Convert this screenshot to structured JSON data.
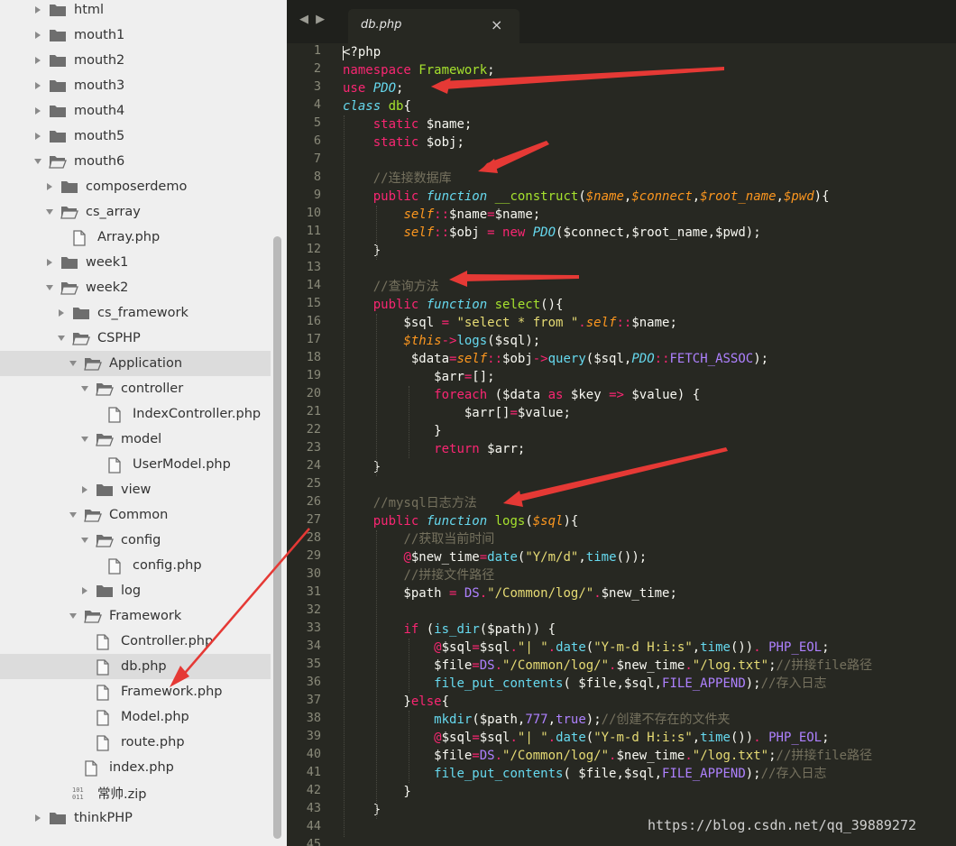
{
  "sidebar": {
    "items": [
      {
        "label": "html",
        "type": "folder",
        "state": "closed",
        "depth": 0
      },
      {
        "label": "mouth1",
        "type": "folder",
        "state": "closed",
        "depth": 0
      },
      {
        "label": "mouth2",
        "type": "folder",
        "state": "closed",
        "depth": 0
      },
      {
        "label": "mouth3",
        "type": "folder",
        "state": "closed",
        "depth": 0
      },
      {
        "label": "mouth4",
        "type": "folder",
        "state": "closed",
        "depth": 0
      },
      {
        "label": "mouth5",
        "type": "folder",
        "state": "closed",
        "depth": 0
      },
      {
        "label": "mouth6",
        "type": "folder",
        "state": "open",
        "depth": 0
      },
      {
        "label": "composerdemo",
        "type": "folder",
        "state": "closed",
        "depth": 1
      },
      {
        "label": "cs_array",
        "type": "folder",
        "state": "open",
        "depth": 1
      },
      {
        "label": "Array.php",
        "type": "file",
        "depth": 2
      },
      {
        "label": "week1",
        "type": "folder",
        "state": "closed",
        "depth": 1
      },
      {
        "label": "week2",
        "type": "folder",
        "state": "open",
        "depth": 1
      },
      {
        "label": "cs_framework",
        "type": "folder",
        "state": "closed",
        "depth": 2
      },
      {
        "label": "CSPHP",
        "type": "folder",
        "state": "open",
        "depth": 2
      },
      {
        "label": "Application",
        "type": "folder",
        "state": "open",
        "depth": 3,
        "selected": true
      },
      {
        "label": "controller",
        "type": "folder",
        "state": "open",
        "depth": 4
      },
      {
        "label": "IndexController.php",
        "type": "file",
        "depth": 5
      },
      {
        "label": "model",
        "type": "folder",
        "state": "open",
        "depth": 4
      },
      {
        "label": "UserModel.php",
        "type": "file",
        "depth": 5
      },
      {
        "label": "view",
        "type": "folder",
        "state": "closed",
        "depth": 4
      },
      {
        "label": "Common",
        "type": "folder",
        "state": "open",
        "depth": 3
      },
      {
        "label": "config",
        "type": "folder",
        "state": "open",
        "depth": 4
      },
      {
        "label": "config.php",
        "type": "file",
        "depth": 5
      },
      {
        "label": "log",
        "type": "folder",
        "state": "closed",
        "depth": 4
      },
      {
        "label": "Framework",
        "type": "folder",
        "state": "open",
        "depth": 3
      },
      {
        "label": "Controller.php",
        "type": "file",
        "depth": 4
      },
      {
        "label": "db.php",
        "type": "file",
        "depth": 4,
        "selected": true
      },
      {
        "label": "Framework.php",
        "type": "file",
        "depth": 4
      },
      {
        "label": "Model.php",
        "type": "file",
        "depth": 4
      },
      {
        "label": "route.php",
        "type": "file",
        "depth": 4
      },
      {
        "label": "index.php",
        "type": "file",
        "depth": 3
      },
      {
        "label": "常帅.zip",
        "type": "zip",
        "depth": 2
      },
      {
        "label": "thinkPHP",
        "type": "folder",
        "state": "closed",
        "depth": 0
      }
    ]
  },
  "editor": {
    "tab_nav": "◀ ▶",
    "tab_title": "db.php",
    "tab_close": "×",
    "line_numbers": [
      "1",
      "2",
      "3",
      "4",
      "5",
      "6",
      "7",
      "8",
      "9",
      "10",
      "11",
      "12",
      "13",
      "14",
      "15",
      "16",
      "17",
      "18",
      "19",
      "20",
      "21",
      "22",
      "23",
      "24",
      "25",
      "26",
      "27",
      "28",
      "29",
      "30",
      "31",
      "32",
      "33",
      "34",
      "35",
      "36",
      "37",
      "38",
      "39",
      "40",
      "41",
      "42",
      "43",
      "44",
      "45"
    ],
    "lines": [
      [
        [
          "w",
          "<?php"
        ]
      ],
      [
        [
          "k",
          "namespace "
        ],
        [
          "n",
          "Framework"
        ],
        [
          "w",
          ";"
        ]
      ],
      [
        [
          "k",
          "use "
        ],
        [
          "s",
          "PDO"
        ],
        [
          "w",
          ";"
        ]
      ],
      [
        [
          "s",
          "class "
        ],
        [
          "n",
          "db"
        ],
        [
          "w",
          "{"
        ]
      ],
      [
        [
          "w",
          "    "
        ],
        [
          "k",
          "static "
        ],
        [
          "w",
          "$name;"
        ]
      ],
      [
        [
          "w",
          "    "
        ],
        [
          "k",
          "static "
        ],
        [
          "w",
          "$obj;"
        ]
      ],
      [
        [
          "w",
          ""
        ]
      ],
      [
        [
          "w",
          "    "
        ],
        [
          "c",
          "//连接数据库"
        ]
      ],
      [
        [
          "w",
          "    "
        ],
        [
          "k",
          "public "
        ],
        [
          "s",
          "function "
        ],
        [
          "n",
          "__construct"
        ],
        [
          "w",
          "("
        ],
        [
          "p",
          "$name"
        ],
        [
          "w",
          ","
        ],
        [
          "p",
          "$connect"
        ],
        [
          "w",
          ","
        ],
        [
          "p",
          "$root_name"
        ],
        [
          "w",
          ","
        ],
        [
          "p",
          "$pwd"
        ],
        [
          "w",
          "){"
        ]
      ],
      [
        [
          "w",
          "        "
        ],
        [
          "p",
          "self"
        ],
        [
          "k",
          "::"
        ],
        [
          "w",
          "$name"
        ],
        [
          "k",
          "="
        ],
        [
          "w",
          "$name;"
        ]
      ],
      [
        [
          "w",
          "        "
        ],
        [
          "p",
          "self"
        ],
        [
          "k",
          "::"
        ],
        [
          "w",
          "$obj "
        ],
        [
          "k",
          "= new "
        ],
        [
          "s",
          "PDO"
        ],
        [
          "w",
          "($connect,$root_name,$pwd);"
        ]
      ],
      [
        [
          "w",
          "    }"
        ]
      ],
      [
        [
          "w",
          ""
        ]
      ],
      [
        [
          "w",
          "    "
        ],
        [
          "c",
          "//查询方法"
        ]
      ],
      [
        [
          "w",
          "    "
        ],
        [
          "k",
          "public "
        ],
        [
          "s",
          "function "
        ],
        [
          "n",
          "select"
        ],
        [
          "w",
          "(){"
        ]
      ],
      [
        [
          "w",
          "        $sql "
        ],
        [
          "k",
          "= "
        ],
        [
          "str",
          "\"select * from \""
        ],
        [
          "k",
          "."
        ],
        [
          "p",
          "self"
        ],
        [
          "k",
          "::"
        ],
        [
          "w",
          "$name;"
        ]
      ],
      [
        [
          "w",
          "        "
        ],
        [
          "p",
          "$this"
        ],
        [
          "k",
          "->"
        ],
        [
          "fn",
          "logs"
        ],
        [
          "w",
          "($sql);"
        ]
      ],
      [
        [
          "w",
          "         $data"
        ],
        [
          "k",
          "="
        ],
        [
          "p",
          "self"
        ],
        [
          "k",
          "::"
        ],
        [
          "w",
          "$obj"
        ],
        [
          "k",
          "->"
        ],
        [
          "fn",
          "query"
        ],
        [
          "w",
          "($sql,"
        ],
        [
          "s",
          "PDO"
        ],
        [
          "k",
          "::"
        ],
        [
          "cn",
          "FETCH_ASSOC"
        ],
        [
          "w",
          ");"
        ]
      ],
      [
        [
          "w",
          "            $arr"
        ],
        [
          "k",
          "="
        ],
        [
          "w",
          "[];"
        ]
      ],
      [
        [
          "w",
          "            "
        ],
        [
          "k",
          "foreach "
        ],
        [
          "w",
          "($data "
        ],
        [
          "k",
          "as "
        ],
        [
          "w",
          "$key "
        ],
        [
          "k",
          "=> "
        ],
        [
          "w",
          "$value) {"
        ]
      ],
      [
        [
          "w",
          "                $arr[]"
        ],
        [
          "k",
          "="
        ],
        [
          "w",
          "$value;"
        ]
      ],
      [
        [
          "w",
          "            }"
        ]
      ],
      [
        [
          "w",
          "            "
        ],
        [
          "k",
          "return "
        ],
        [
          "w",
          "$arr;"
        ]
      ],
      [
        [
          "w",
          "    }"
        ]
      ],
      [
        [
          "w",
          ""
        ]
      ],
      [
        [
          "w",
          "    "
        ],
        [
          "c",
          "//mysql日志方法"
        ]
      ],
      [
        [
          "w",
          "    "
        ],
        [
          "k",
          "public "
        ],
        [
          "s",
          "function "
        ],
        [
          "n",
          "logs"
        ],
        [
          "w",
          "("
        ],
        [
          "p",
          "$sql"
        ],
        [
          "w",
          "){"
        ]
      ],
      [
        [
          "w",
          "        "
        ],
        [
          "c",
          "//获取当前时间"
        ]
      ],
      [
        [
          "w",
          "        "
        ],
        [
          "k",
          "@"
        ],
        [
          "w",
          "$new_time"
        ],
        [
          "k",
          "="
        ],
        [
          "fn",
          "date"
        ],
        [
          "w",
          "("
        ],
        [
          "str",
          "\"Y/m/d\""
        ],
        [
          "w",
          ","
        ],
        [
          "fn",
          "time"
        ],
        [
          "w",
          "());"
        ]
      ],
      [
        [
          "w",
          "        "
        ],
        [
          "c",
          "//拼接文件路径"
        ]
      ],
      [
        [
          "w",
          "        $path "
        ],
        [
          "k",
          "= "
        ],
        [
          "cn",
          "DS"
        ],
        [
          "k",
          "."
        ],
        [
          "str",
          "\"/Common/log/\""
        ],
        [
          "k",
          "."
        ],
        [
          "w",
          "$new_time;"
        ]
      ],
      [
        [
          "w",
          ""
        ]
      ],
      [
        [
          "w",
          "        "
        ],
        [
          "k",
          "if "
        ],
        [
          "w",
          "("
        ],
        [
          "fn",
          "is_dir"
        ],
        [
          "w",
          "($path)) {"
        ]
      ],
      [
        [
          "w",
          "            "
        ],
        [
          "k",
          "@"
        ],
        [
          "w",
          "$sql"
        ],
        [
          "k",
          "="
        ],
        [
          "w",
          "$sql"
        ],
        [
          "k",
          "."
        ],
        [
          "str",
          "\"| \""
        ],
        [
          "k",
          "."
        ],
        [
          "fn",
          "date"
        ],
        [
          "w",
          "("
        ],
        [
          "str",
          "\"Y-m-d H:i:s\""
        ],
        [
          "w",
          ","
        ],
        [
          "fn",
          "time"
        ],
        [
          "w",
          "())"
        ],
        [
          "k",
          ". "
        ],
        [
          "cn",
          "PHP_EOL"
        ],
        [
          "w",
          ";"
        ]
      ],
      [
        [
          "w",
          "            $file"
        ],
        [
          "k",
          "="
        ],
        [
          "cn",
          "DS"
        ],
        [
          "k",
          "."
        ],
        [
          "str",
          "\"/Common/log/\""
        ],
        [
          "k",
          "."
        ],
        [
          "w",
          "$new_time"
        ],
        [
          "k",
          "."
        ],
        [
          "str",
          "\"/log.txt\""
        ],
        [
          "w",
          ";"
        ],
        [
          "c",
          "//拼接file路径"
        ]
      ],
      [
        [
          "w",
          "            "
        ],
        [
          "fn",
          "file_put_contents"
        ],
        [
          "w",
          "( $file,$sql,"
        ],
        [
          "cn",
          "FILE_APPEND"
        ],
        [
          "w",
          ");"
        ],
        [
          "c",
          "//存入日志"
        ]
      ],
      [
        [
          "w",
          "        }"
        ],
        [
          "k",
          "else"
        ],
        [
          "w",
          "{"
        ]
      ],
      [
        [
          "w",
          "            "
        ],
        [
          "fn",
          "mkdir"
        ],
        [
          "w",
          "($path,"
        ],
        [
          "num",
          "777"
        ],
        [
          "w",
          ","
        ],
        [
          "num",
          "true"
        ],
        [
          "w",
          ");"
        ],
        [
          "c",
          "//创建不存在的文件夹"
        ]
      ],
      [
        [
          "w",
          "            "
        ],
        [
          "k",
          "@"
        ],
        [
          "w",
          "$sql"
        ],
        [
          "k",
          "="
        ],
        [
          "w",
          "$sql"
        ],
        [
          "k",
          "."
        ],
        [
          "str",
          "\"| \""
        ],
        [
          "k",
          "."
        ],
        [
          "fn",
          "date"
        ],
        [
          "w",
          "("
        ],
        [
          "str",
          "\"Y-m-d H:i:s\""
        ],
        [
          "w",
          ","
        ],
        [
          "fn",
          "time"
        ],
        [
          "w",
          "())"
        ],
        [
          "k",
          ". "
        ],
        [
          "cn",
          "PHP_EOL"
        ],
        [
          "w",
          ";"
        ]
      ],
      [
        [
          "w",
          "            $file"
        ],
        [
          "k",
          "="
        ],
        [
          "cn",
          "DS"
        ],
        [
          "k",
          "."
        ],
        [
          "str",
          "\"/Common/log/\""
        ],
        [
          "k",
          "."
        ],
        [
          "w",
          "$new_time"
        ],
        [
          "k",
          "."
        ],
        [
          "str",
          "\"/log.txt\""
        ],
        [
          "w",
          ";"
        ],
        [
          "c",
          "//拼接file路径"
        ]
      ],
      [
        [
          "w",
          "            "
        ],
        [
          "fn",
          "file_put_contents"
        ],
        [
          "w",
          "( $file,$sql,"
        ],
        [
          "cn",
          "FILE_APPEND"
        ],
        [
          "w",
          ");"
        ],
        [
          "c",
          "//存入日志"
        ]
      ],
      [
        [
          "w",
          "        }"
        ]
      ],
      [
        [
          "w",
          "    }"
        ]
      ],
      [
        [
          "w",
          ""
        ]
      ],
      [
        [
          "w",
          ""
        ]
      ]
    ],
    "watermark": "https://blog.csdn.net/qq_39889272"
  },
  "colors": {
    "editor_bg": "#272822",
    "keyword": "#f92672",
    "storage": "#66d9ef",
    "entity": "#a6e22e",
    "param": "#fd971f",
    "string": "#e6db74",
    "comment": "#75715e",
    "constant": "#ae81ff",
    "annotation_arrow": "#e53935"
  }
}
